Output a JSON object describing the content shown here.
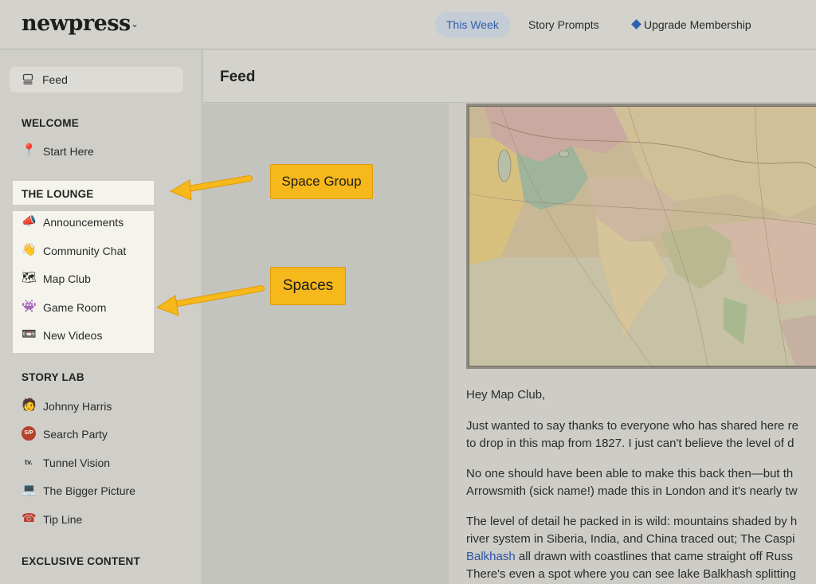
{
  "header": {
    "logo": "newpress",
    "logo_chevron": "⌄",
    "tabs": [
      {
        "label": "This Week",
        "active": true
      },
      {
        "label": "Story Prompts",
        "active": false
      },
      {
        "label": "Upgrade Membership",
        "active": false,
        "icon": "diamond-icon"
      }
    ]
  },
  "sidebar": {
    "feed": {
      "label": "Feed",
      "icon": "feed-icon"
    },
    "groups": [
      {
        "title": "WELCOME",
        "items": [
          {
            "emoji": "📍",
            "label": "Start Here"
          }
        ]
      },
      {
        "title": "THE LOUNGE",
        "items": [
          {
            "emoji": "📣",
            "label": "Announcements"
          },
          {
            "emoji": "👋",
            "label": "Community Chat"
          },
          {
            "emoji": "🗺",
            "label": "Map Club"
          },
          {
            "emoji": "👾",
            "label": "Game Room"
          },
          {
            "emoji": "📼",
            "label": "New Videos"
          }
        ]
      },
      {
        "title": "STORY LAB",
        "items": [
          {
            "emoji": "🧑",
            "label": "Johnny Harris"
          },
          {
            "emoji": "S/P",
            "label": "Search Party"
          },
          {
            "emoji": "tv.",
            "label": "Tunnel Vision"
          },
          {
            "emoji": "💻",
            "label": "The Bigger Picture"
          },
          {
            "emoji": "☎",
            "label": "Tip Line"
          }
        ]
      },
      {
        "title": "EXCLUSIVE CONTENT",
        "items": []
      }
    ]
  },
  "main": {
    "title": "Feed",
    "post": {
      "greeting": "Hey Map Club,",
      "lines": [
        "Just wanted to say thanks to everyone who has shared here re",
        "to drop in this map from 1827. I just can't believe the level of d",
        "No one should have been able to make this back then—but th",
        "Arrowsmith (sick name!) made this in London and it's nearly tw",
        "The level of detail he packed in is wild: mountains shaded by h",
        "river system in Siberia, India, and China traced out; The Caspi",
        "all drawn with coastlines that came straight off Russ",
        "There's even a spot where you can see lake Balkhash splitting"
      ],
      "link": "Balkhash"
    }
  },
  "annotations": {
    "space_group": "Space Group",
    "spaces": "Spaces"
  },
  "colors": {
    "accent": "#f6b81a",
    "active_tab_text": "#2f5fa8",
    "link": "#2a54a8"
  }
}
